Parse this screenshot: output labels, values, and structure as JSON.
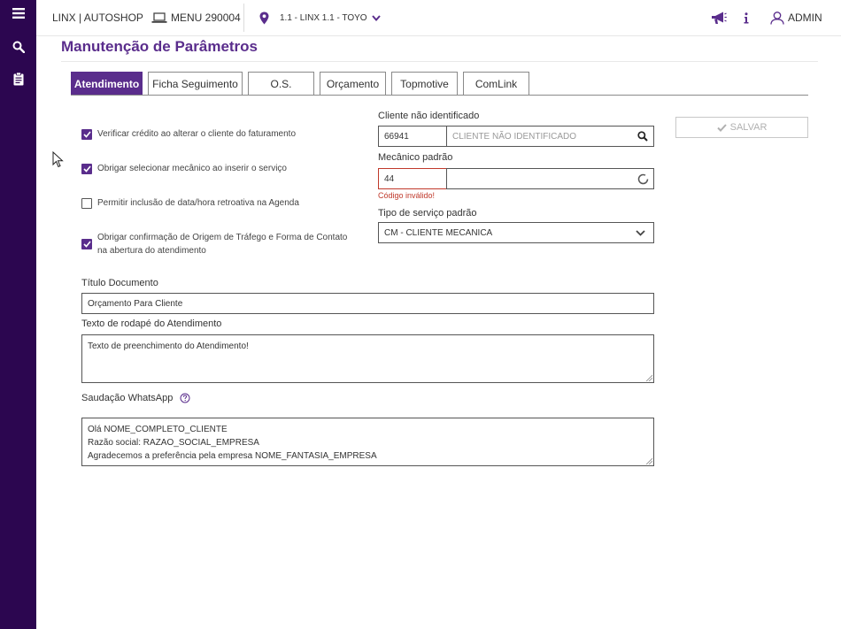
{
  "topbar": {
    "brand": "LINX | AUTOSHOP",
    "menu": "MENU 290004",
    "branch": "1.1 - LINX 1.1 - TOYO",
    "user": "ADMIN"
  },
  "page": {
    "title": "Manutenção de Parâmetros"
  },
  "tabs": [
    {
      "label": "Atendimento",
      "active": true
    },
    {
      "label": "Ficha Seguimento"
    },
    {
      "label": "O.S."
    },
    {
      "label": "Orçamento"
    },
    {
      "label": "Topmotive"
    },
    {
      "label": "ComLink"
    }
  ],
  "options": [
    {
      "label": "Verificar crédito ao alterar o cliente do faturamento",
      "checked": true
    },
    {
      "label": "Obrigar selecionar mecânico ao inserir o serviço",
      "checked": true
    },
    {
      "label": "Permitir inclusão de data/hora retroativa na Agenda",
      "checked": false
    },
    {
      "label_line1": "Obrigar confirmação de Origem de Tráfego e Forma de Contato",
      "label_line2": "na abertura do atendimento",
      "checked": true
    }
  ],
  "cliente": {
    "label": "Cliente não identificado",
    "code": "66941",
    "name_placeholder": "CLIENTE NÃO IDENTIFICADO"
  },
  "mecanico": {
    "label": "Mecânico padrão",
    "code": "44",
    "error": "Código inválido!"
  },
  "tipo_servico": {
    "label": "Tipo de serviço padrão",
    "selected": "CM - CLIENTE MECANICA"
  },
  "save_button": "SALVAR",
  "titulo_documento": {
    "label": "Título Documento",
    "value": "Orçamento Para Cliente"
  },
  "rodape": {
    "label": "Texto de rodapé do Atendimento",
    "value": "Texto de preenchimento do Atendimento!"
  },
  "whatsapp": {
    "label": "Saudação WhatsApp",
    "lines": [
      "Olá NOME_COMPLETO_CLIENTE",
      "Razão social: RAZAO_SOCIAL_EMPRESA",
      "Agradecemos a preferência pela empresa NOME_FANTASIA_EMPRESA"
    ]
  },
  "colors": {
    "sidebar": "#2c0650",
    "accent": "#5a2d8c",
    "error": "#c0392b"
  },
  "icons": [
    "hamburger-icon",
    "search-icon",
    "clipboard-icon",
    "laptop-icon",
    "location-pin-icon",
    "chevron-down-icon",
    "megaphone-icon",
    "info-icon",
    "user-icon",
    "magnifier-icon",
    "spinner-icon",
    "check-icon",
    "help-circle-icon",
    "cursor-icon"
  ]
}
